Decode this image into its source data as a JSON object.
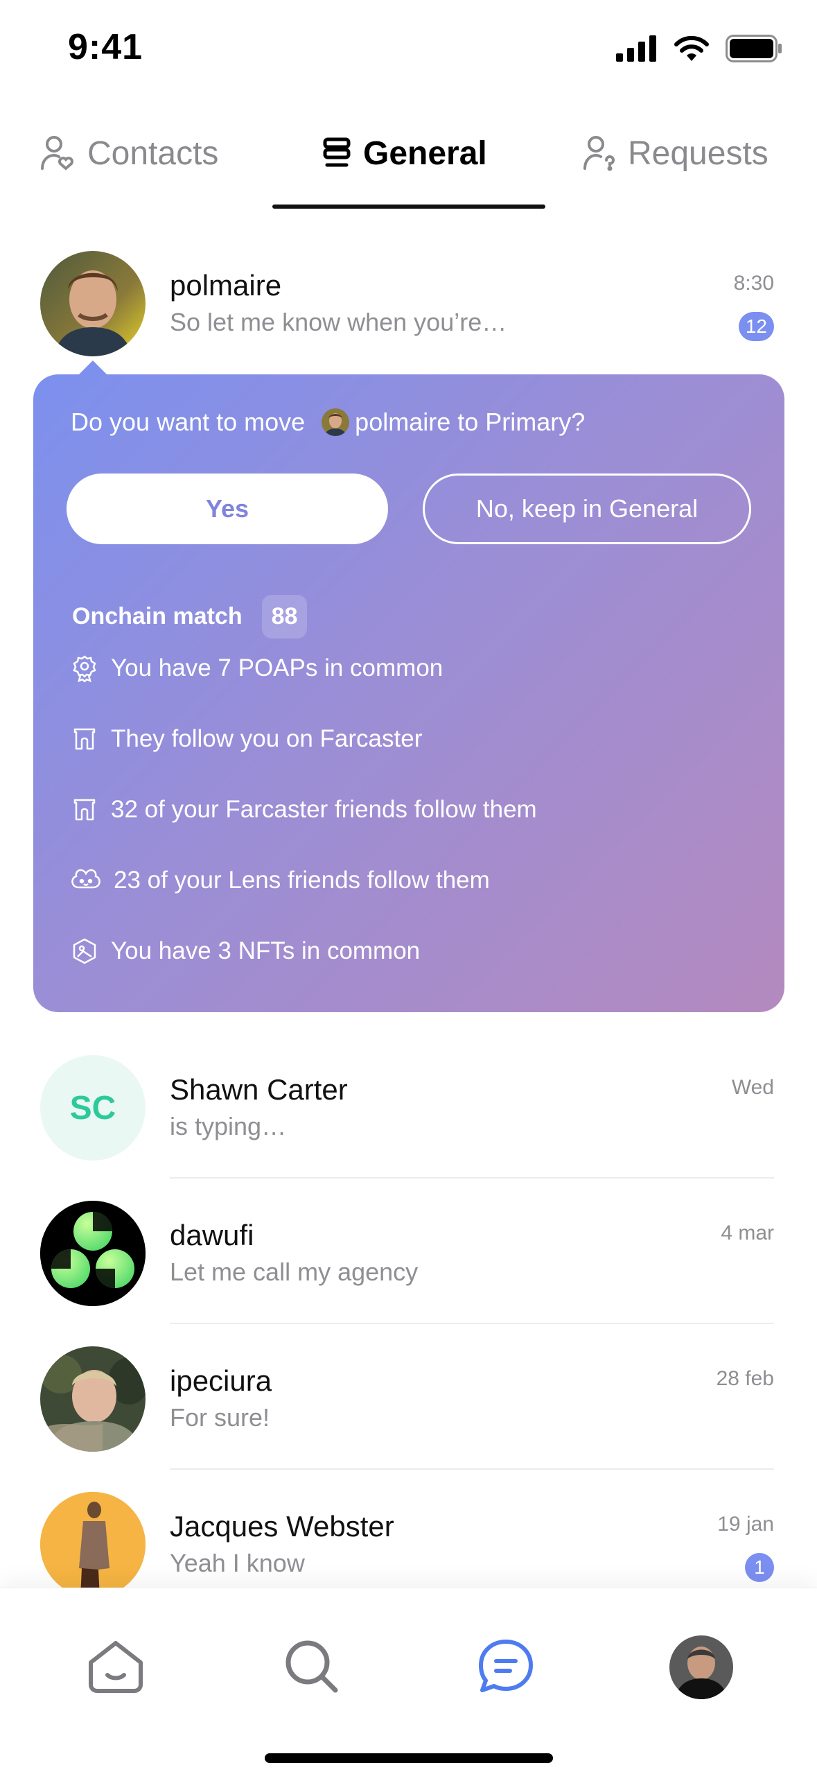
{
  "status_bar": {
    "time": "9:41"
  },
  "tabs": [
    {
      "label": "Contacts",
      "icon": "user-heart-icon"
    },
    {
      "label": "General",
      "icon": "stack-icon",
      "active": true
    },
    {
      "label": "Requests",
      "icon": "user-question-icon"
    }
  ],
  "chats": [
    {
      "name": "polmaire",
      "message": "So let me know when you’re…",
      "time": "8:30",
      "unread": "12",
      "avatar": "photo"
    },
    {
      "name": "Shawn Carter",
      "message": "is typing…",
      "time": "Wed",
      "initials": "SC"
    },
    {
      "name": "dawufi",
      "message": "Let me call my agency",
      "time": "4 mar",
      "avatar": "logo"
    },
    {
      "name": "ipeciura",
      "message": "For sure!",
      "time": "28 feb",
      "avatar": "photo"
    },
    {
      "name": "Jacques Webster",
      "message": "Yeah I know",
      "time": "19 jan",
      "unread": "1",
      "avatar": "photo"
    }
  ],
  "suggestion": {
    "prompt_prefix": "Do you want to move",
    "prompt_name": "polmaire to Primary?",
    "yes_label": "Yes",
    "no_label": "No, keep in General",
    "match_label": "Onchain match",
    "match_score": "88",
    "reasons": [
      {
        "icon": "poap-icon",
        "text": "You have 7 POAPs in common"
      },
      {
        "icon": "farcaster-icon",
        "text": "They follow you on Farcaster"
      },
      {
        "icon": "farcaster-icon",
        "text": "32 of your Farcaster friends follow them"
      },
      {
        "icon": "lens-icon",
        "text": "23 of your Lens friends follow them"
      },
      {
        "icon": "nft-icon",
        "text": "You have 3 NFTs in common"
      }
    ]
  },
  "nav": [
    {
      "icon": "home-icon"
    },
    {
      "icon": "search-icon"
    },
    {
      "icon": "messages-icon",
      "active": true
    },
    {
      "icon": "profile-avatar"
    }
  ],
  "colors": {
    "accent": "#7b8ff0",
    "card_start": "#7c90ee",
    "card_end": "#b48abf",
    "active_nav": "#4e7cf0"
  }
}
